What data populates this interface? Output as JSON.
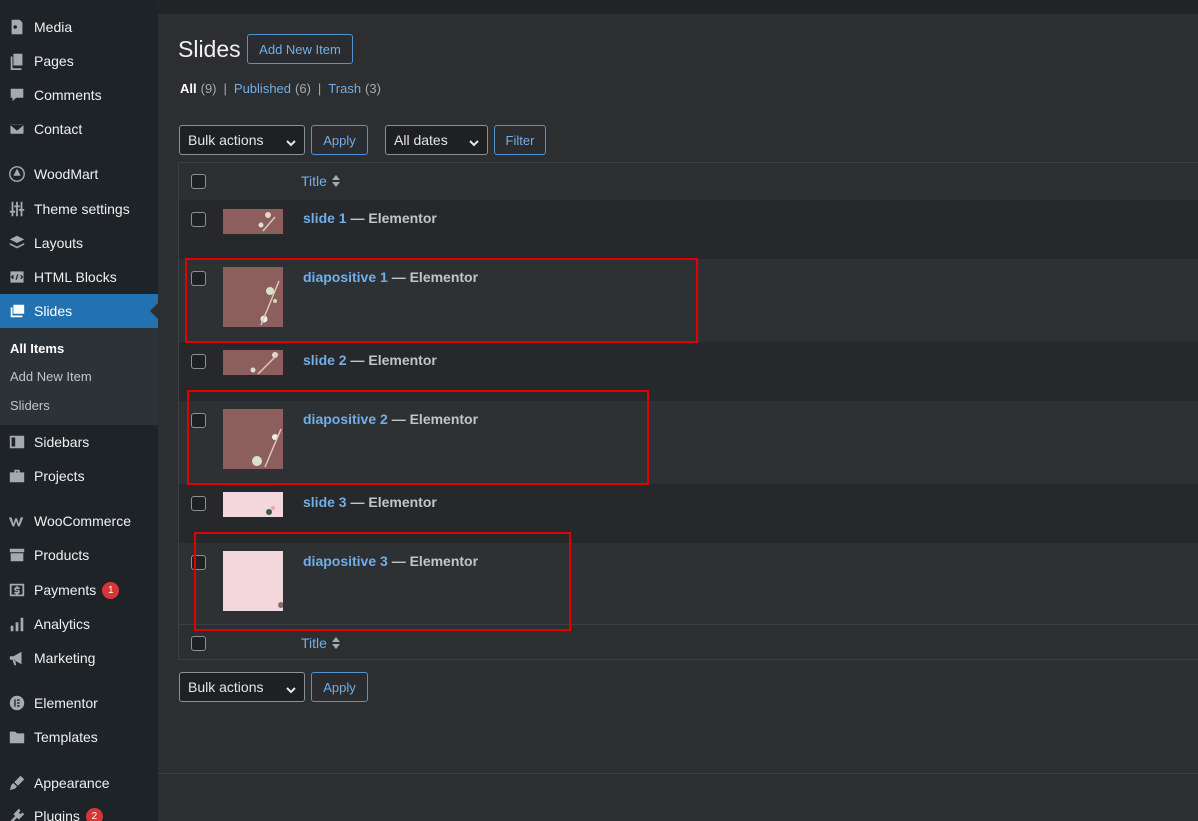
{
  "sidebar": {
    "items": [
      {
        "label": "Media",
        "icon": "media-icon"
      },
      {
        "label": "Pages",
        "icon": "pages-icon"
      },
      {
        "label": "Comments",
        "icon": "comments-icon"
      },
      {
        "label": "Contact",
        "icon": "mail-icon"
      },
      {
        "label": "WoodMart",
        "icon": "woodmart-icon"
      },
      {
        "label": "Theme settings",
        "icon": "sliders-icon"
      },
      {
        "label": "Layouts",
        "icon": "layers-icon"
      },
      {
        "label": "HTML Blocks",
        "icon": "code-icon"
      },
      {
        "label": "Slides",
        "icon": "slides-icon"
      },
      {
        "label": "Sidebars",
        "icon": "sidebar-icon"
      },
      {
        "label": "Projects",
        "icon": "briefcase-icon"
      },
      {
        "label": "WooCommerce",
        "icon": "woocommerce-icon"
      },
      {
        "label": "Products",
        "icon": "archive-icon"
      },
      {
        "label": "Payments",
        "icon": "dollar-icon",
        "badge": "1"
      },
      {
        "label": "Analytics",
        "icon": "bar-chart-icon"
      },
      {
        "label": "Marketing",
        "icon": "megaphone-icon"
      },
      {
        "label": "Elementor",
        "icon": "elementor-icon"
      },
      {
        "label": "Templates",
        "icon": "folder-icon"
      },
      {
        "label": "Appearance",
        "icon": "paintbrush-icon"
      },
      {
        "label": "Plugins",
        "icon": "plugin-icon",
        "badge": "2"
      }
    ],
    "submenu": [
      {
        "label": "All Items"
      },
      {
        "label": "Add New Item"
      },
      {
        "label": "Sliders"
      }
    ]
  },
  "header": {
    "title": "Slides",
    "add_new_label": "Add New Item"
  },
  "filters": {
    "all_label": "All",
    "all_count": "(9)",
    "published_label": "Published",
    "published_count": "(6)",
    "trash_label": "Trash",
    "trash_count": "(3)",
    "separator": "|"
  },
  "tablenav_top": {
    "bulk_actions": "Bulk actions",
    "apply_label": "Apply",
    "dates": "All dates",
    "filter_label": "Filter"
  },
  "table": {
    "column_title": "Title",
    "rows": [
      {
        "title": "slide 1",
        "state": " — Elementor"
      },
      {
        "title": "diapositive 1",
        "state": " — Elementor"
      },
      {
        "title": "slide 2",
        "state": " — Elementor"
      },
      {
        "title": "diapositive 2",
        "state": " — Elementor"
      },
      {
        "title": "slide 3",
        "state": " — Elementor"
      },
      {
        "title": "diapositive 3",
        "state": " — Elementor"
      }
    ]
  },
  "tablenav_bottom": {
    "bulk_actions": "Bulk actions",
    "apply_label": "Apply"
  },
  "colors": {
    "accent": "#2271b1",
    "link": "#72aee6",
    "highlight": "#e00000",
    "badge": "#d63638"
  }
}
